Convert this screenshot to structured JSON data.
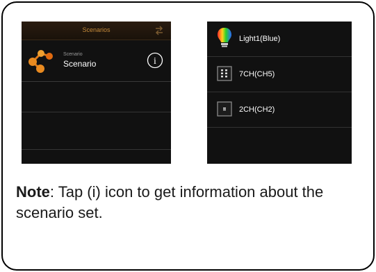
{
  "left_screen": {
    "header_title": "Scenarios",
    "row": {
      "sub_label": "Scenario",
      "name": "Scenario",
      "info_glyph": "i"
    }
  },
  "right_screen": {
    "items": [
      {
        "label": "Light1(Blue)",
        "icon": "rgb-bulb-icon"
      },
      {
        "label": "7CH(CH5)",
        "icon": "channel-module-icon"
      },
      {
        "label": "2CH(CH2)",
        "icon": "channel-module-icon"
      }
    ]
  },
  "note": {
    "bold": "Note",
    "text": ": Tap (i) icon to get information about the scenario set."
  },
  "colors": {
    "accent": "#c48a3a",
    "screen_bg": "#111111"
  }
}
